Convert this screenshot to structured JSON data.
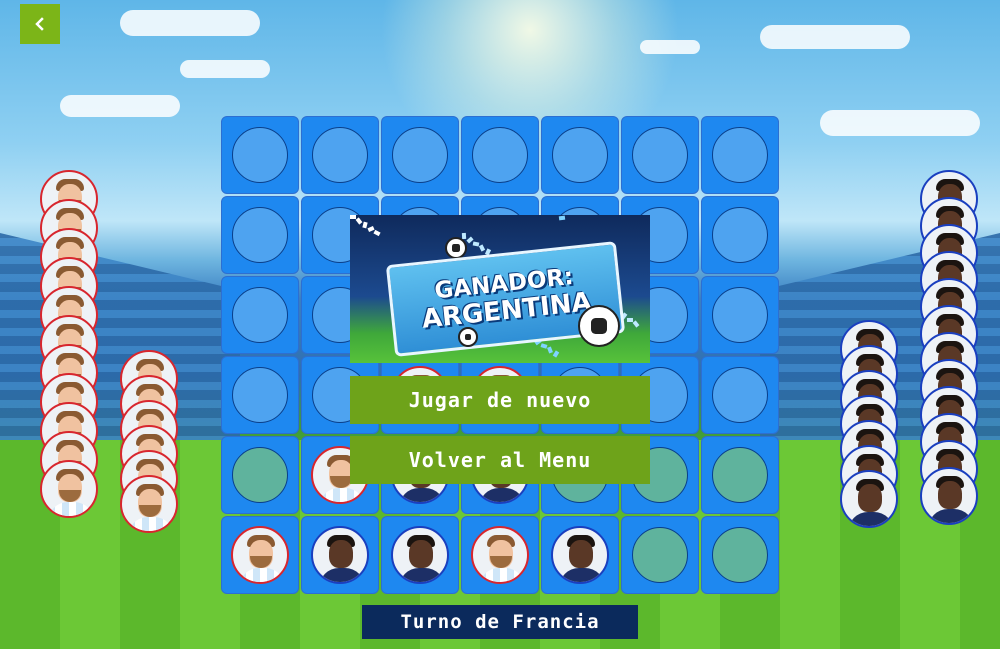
{
  "nav": {
    "back_icon": "chevron-left-icon"
  },
  "game": {
    "columns": 7,
    "rows": 6,
    "players": [
      {
        "id": "arg",
        "name": "Argentina",
        "border_color": "#d8262e"
      },
      {
        "id": "fra",
        "name": "Francia",
        "border_color": "#1a3fbf"
      }
    ],
    "board": [
      [
        "",
        "",
        "",
        "",
        "",
        "",
        ""
      ],
      [
        "",
        "",
        "",
        "",
        "",
        "",
        ""
      ],
      [
        "",
        "",
        "",
        "",
        "",
        "",
        ""
      ],
      [
        "",
        "",
        "arg",
        "arg",
        "",
        "",
        ""
      ],
      [
        "",
        "arg",
        "fra",
        "fra",
        "",
        "",
        ""
      ],
      [
        "arg",
        "fra",
        "fra",
        "arg",
        "fra",
        "",
        ""
      ]
    ],
    "reserve": {
      "arg_left_column": 11,
      "arg_right_column": 6,
      "fra_left_column": 7,
      "fra_right_column": 12
    }
  },
  "result": {
    "banner_line1": "GANADOR:",
    "banner_line2": "ARGENTINA",
    "play_again_label": "Jugar de nuevo",
    "menu_label": "Volver al Menu"
  },
  "status": {
    "turn_text": "Turno de Francia"
  },
  "colors": {
    "accent": "#6ea31a",
    "board": "#1e88f0",
    "status_bg": "#0b2a5c"
  }
}
